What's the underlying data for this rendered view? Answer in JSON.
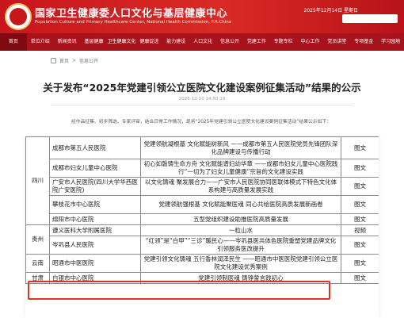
{
  "header": {
    "title": "国家卫生健康委人口文化与基层健康中心",
    "subtitle": "Population Culture and Primary Healthcare Center, National Health Commission, P.R.China",
    "date": "2025年12月14日 星期日"
  },
  "nav": {
    "items": [
      "首页",
      "单位介绍",
      "新闻资讯",
      "基层健康",
      "卫生健康文化",
      "健康促进",
      "能力建设",
      "人口文化",
      "信息公开",
      "党建工作",
      "专题专栏",
      "中心工作",
      "党员讲堂",
      "专项基金",
      "学习园地"
    ]
  },
  "breadcrumb": {
    "items": [
      "首页",
      "信息公开"
    ]
  },
  "article": {
    "title": "关于发布“2025年党建引领公立医院文化建设案例征集活动”结果的公示",
    "meta": "2025-12-10  14:50:19",
    "body": "经作品征集、初步筛选、专家评审，结合日常工作情况，现将“2025年党建引领公立医院文化建设案例征集活动”结果公示如下："
  },
  "table": {
    "rows": [
      {
        "province": "四川",
        "unit": "成都市第五人民医院",
        "case": "党建领航凝根基 文化赋能树新风 ——成都市第五人民医院党员先锋团队深化品牌建设与传播行动",
        "form": "图文"
      },
      {
        "province": "",
        "unit": "成都市妇女儿童中心医院",
        "case": "初心如磐铸生命方舟 文化赋能谱妇幼华章 ——成都市妇女儿童中心医院践行“一切为了妇女儿童健康”宗旨的文化建设实践",
        "form": "图文"
      },
      {
        "province": "",
        "unit": "广安市人民医院(四川大学华西医院广安医院)",
        "case": "以文化铸魂 聚发展合力——广安市人民医院协同医联体模式下特色文化体系构建与高质量发展实践",
        "form": "图文"
      },
      {
        "province": "",
        "unit": "攀枝花市中心医院",
        "case": "党建领航强根基 文化赋能聚医魂 同心共绘医院高质发展新画卷",
        "form": "图文"
      },
      {
        "province": "",
        "unit": "绵阳市中心医院",
        "case": "五型党组织建设助推医院高质量发展",
        "form": "图文"
      },
      {
        "province": "贵州",
        "unit": "遵义医科大学附属医院",
        "case": "一粒山水",
        "form": "视频"
      },
      {
        "province": "",
        "unit": "岑巩县人民医院",
        "case": "“红领”是“白甲”“三诊”暖民心——岑巩县医共体色医院重塑党建品牌文化引领服务医改提升",
        "form": "图文"
      },
      {
        "province": "云南",
        "unit": "昭通市中医医院",
        "case": "党建引领文化铸魂 五行香林润泽民生 ——昭通市中医医院党建引领公立医院文化建设优秀案例",
        "form": "图文"
      },
      {
        "province": "甘肃",
        "unit": "白银市中心医院",
        "case": "党建引领制医魂 铸铮誓言践初心",
        "form": "图文"
      }
    ]
  }
}
